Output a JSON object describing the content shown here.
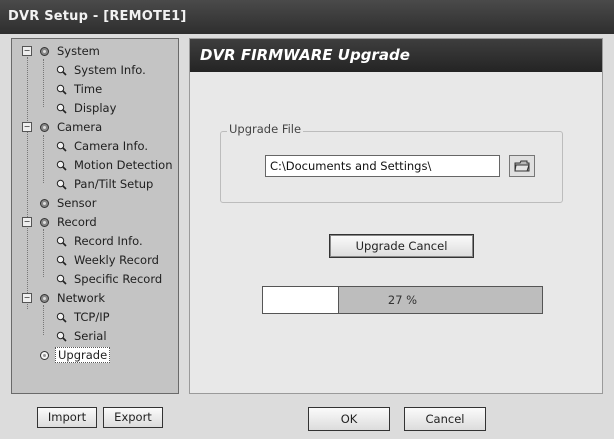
{
  "window": {
    "title": "DVR Setup - [REMOTE1]"
  },
  "tree": {
    "system": {
      "label": "System",
      "children": [
        "System Info.",
        "Time",
        "Display"
      ]
    },
    "camera": {
      "label": "Camera",
      "children": [
        "Camera Info.",
        "Motion Detection",
        "Pan/Tilt Setup"
      ]
    },
    "sensor": {
      "label": "Sensor"
    },
    "record": {
      "label": "Record",
      "children": [
        "Record Info.",
        "Weekly Record",
        "Specific Record"
      ]
    },
    "network": {
      "label": "Network",
      "children": [
        "TCP/IP",
        "Serial"
      ]
    },
    "upgrade": {
      "label": "Upgrade",
      "selected": true
    }
  },
  "panel": {
    "title": "DVR FIRMWARE Upgrade",
    "group_label": "Upgrade File",
    "file_path": "C:\\Documents and Settings\\",
    "upgrade_cancel_label": "Upgrade Cancel",
    "progress_text": "27 %",
    "progress_fraction": 0.27
  },
  "footer": {
    "import_label": "Import",
    "export_label": "Export",
    "ok_label": "OK",
    "cancel_label": "Cancel"
  },
  "icons": {
    "node": "gear-node-icon",
    "leaf": "magnifier-icon",
    "browse": "folder-icon"
  },
  "colors": {
    "titlebar": "#333333",
    "header_bar": "#2e2e2e",
    "sidebar_bg": "#c4c4c4",
    "progress_rest": "#bdbdbd"
  }
}
